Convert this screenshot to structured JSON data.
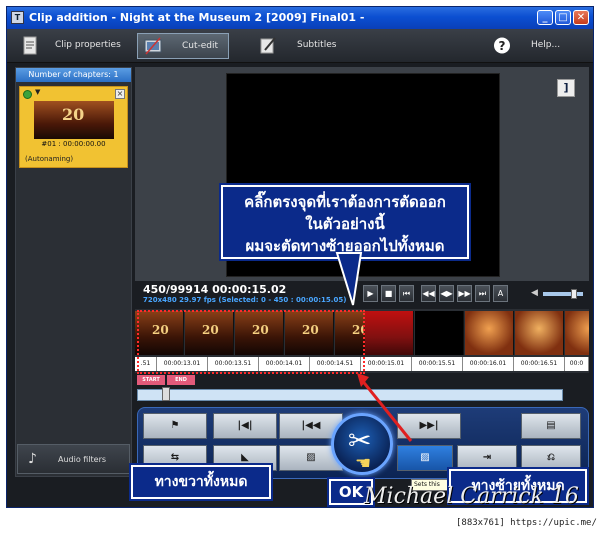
{
  "window": {
    "title": "Clip addition - Night at the Museum 2 [2009] Final01 -",
    "minimize": "_",
    "maximize": "□",
    "close": "✕"
  },
  "toolbar": {
    "items": [
      {
        "label": "Clip properties",
        "icon": "document-icon",
        "active": false
      },
      {
        "label": "Cut-edit",
        "icon": "film-cut-icon",
        "active": true
      },
      {
        "label": "Subtitles",
        "icon": "edit-icon",
        "active": false
      },
      {
        "label": "Help...",
        "icon": "help-icon",
        "active": false
      }
    ]
  },
  "chapters": {
    "header": "Number of chapters: 1",
    "items": [
      {
        "timecode": "#01 : 00:00:00.00",
        "name": "(Autonaming)",
        "thumb_text": "20"
      }
    ]
  },
  "audio_filters": {
    "label": "Audio filters",
    "icon": "music-note-icon"
  },
  "annotations": {
    "top_lines": [
      "คลิ๊กตรงจุดที่เราต้องการตัดออก",
      "ในตัวอย่างนี้",
      "ผมจะตัดทางซ้ายออกไปทั้งหมด"
    ],
    "right_all": "ทางขวาทั้งหมด",
    "ok": "OK",
    "left_all": "ทางซ้ายทั้งหมด",
    "signature": "Michael Carrick 16"
  },
  "info": {
    "frame_time": "450/99914  00:00:15.02",
    "details": "720x480 29.97  fps  (Selected: 0 - 450 : 00:00:15.05)"
  },
  "transport": {
    "buttons": [
      "▶",
      "■",
      "⏮",
      "◀◀",
      "◀▶",
      "▶▶",
      "⏭",
      "A"
    ]
  },
  "timeline": {
    "timecodes": [
      ".51",
      "00:00:13.01",
      "00:00:13.51",
      "00:00:14.01",
      "00:00:14.51",
      "00:00:15.01",
      "00:00:15.51",
      "00:00:16.01",
      "00:00:16.51",
      "00:0"
    ],
    "start_label": "START",
    "end_label": "END"
  },
  "tooltip": "Sets this",
  "footer": "[883x761] https://upic.me/"
}
